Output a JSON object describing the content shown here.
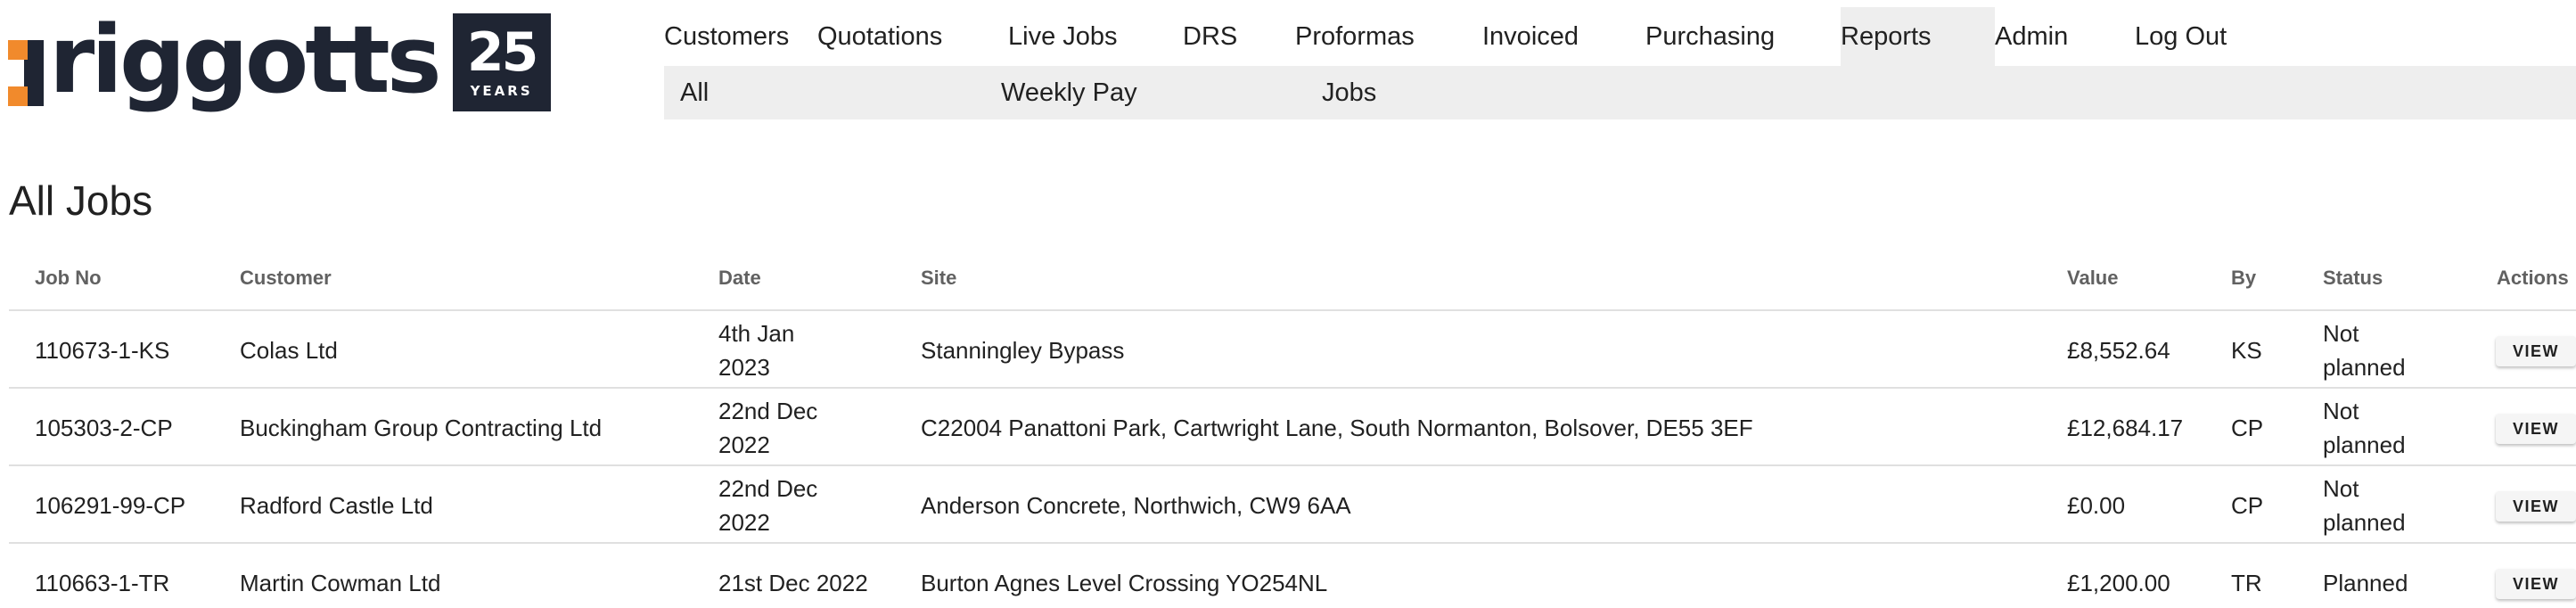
{
  "brand": {
    "wordmark": "riggotts",
    "badge_number": "25",
    "badge_text": "YEARS",
    "accent_color": "#f18a2c",
    "dark_color": "#1f2533"
  },
  "nav": {
    "items": [
      {
        "label": "Customers",
        "active": false
      },
      {
        "label": "Quotations",
        "active": false
      },
      {
        "label": "Live Jobs",
        "active": false
      },
      {
        "label": "DRS",
        "active": false
      },
      {
        "label": "Proformas",
        "active": false
      },
      {
        "label": "Invoiced",
        "active": false
      },
      {
        "label": "Purchasing",
        "active": false
      },
      {
        "label": "Reports",
        "active": true
      },
      {
        "label": "Admin",
        "active": false
      },
      {
        "label": "Log Out",
        "active": false
      }
    ]
  },
  "subnav": {
    "items": [
      {
        "label": "All"
      },
      {
        "label": "Weekly Pay"
      },
      {
        "label": "Jobs"
      }
    ]
  },
  "page": {
    "title": "All Jobs"
  },
  "table": {
    "headers": {
      "job_no": "Job No",
      "customer": "Customer",
      "date": "Date",
      "site": "Site",
      "value": "Value",
      "by": "By",
      "status": "Status",
      "actions": "Actions"
    },
    "view_label": "VIEW",
    "rows": [
      {
        "job_no": "110673-1-KS",
        "customer": "Colas Ltd",
        "date": "4th Jan 2023",
        "site": "Stanningley Bypass",
        "value": "£8,552.64",
        "by": "KS",
        "status": "Not planned"
      },
      {
        "job_no": "105303-2-CP",
        "customer": "Buckingham Group Contracting Ltd",
        "date": "22nd Dec 2022",
        "site": "C22004 Panattoni Park, Cartwright Lane, South Normanton, Bolsover, DE55 3EF",
        "value": "£12,684.17",
        "by": "CP",
        "status": "Not planned"
      },
      {
        "job_no": "106291-99-CP",
        "customer": "Radford Castle Ltd",
        "date": "22nd Dec 2022",
        "site": "Anderson Concrete, Northwich, CW9 6AA",
        "value": "£0.00",
        "by": "CP",
        "status": "Not planned"
      },
      {
        "job_no": "110663-1-TR",
        "customer": "Martin Cowman Ltd",
        "date": "21st Dec 2022",
        "site": "Burton Agnes Level Crossing YO254NL",
        "value": "£1,200.00",
        "by": "TR",
        "status": "Planned"
      }
    ]
  }
}
